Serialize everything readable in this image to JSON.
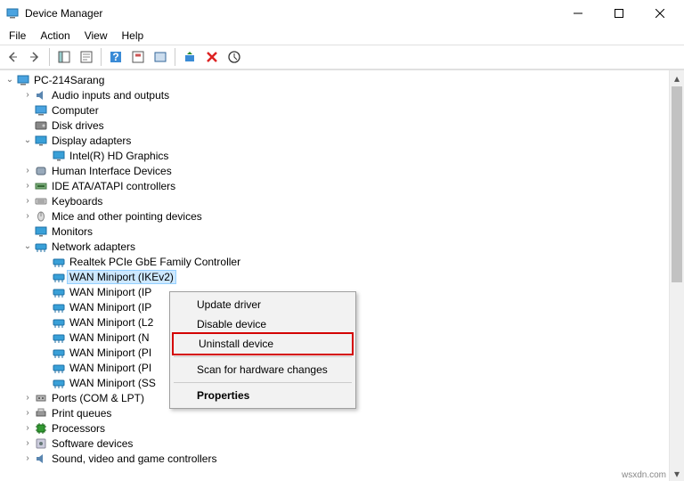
{
  "window": {
    "title": "Device Manager"
  },
  "menubar": [
    "File",
    "Action",
    "View",
    "Help"
  ],
  "tree": {
    "root": "PC-214Sarang",
    "items": [
      {
        "label": "Audio inputs and outputs",
        "expand": ">",
        "icon": "audio"
      },
      {
        "label": "Computer",
        "expand": "",
        "icon": "computer"
      },
      {
        "label": "Disk drives",
        "expand": "",
        "icon": "disk"
      },
      {
        "label": "Display adapters",
        "expand": "v",
        "icon": "display",
        "children": [
          {
            "label": "Intel(R) HD Graphics",
            "icon": "display"
          }
        ]
      },
      {
        "label": "Human Interface Devices",
        "expand": ">",
        "icon": "hid"
      },
      {
        "label": "IDE ATA/ATAPI controllers",
        "expand": ">",
        "icon": "ide"
      },
      {
        "label": "Keyboards",
        "expand": ">",
        "icon": "keyboard"
      },
      {
        "label": "Mice and other pointing devices",
        "expand": ">",
        "icon": "mouse"
      },
      {
        "label": "Monitors",
        "expand": "",
        "icon": "monitor"
      },
      {
        "label": "Network adapters",
        "expand": "v",
        "icon": "network",
        "children": [
          {
            "label": "Realtek PCIe GbE Family Controller",
            "icon": "network"
          },
          {
            "label": "WAN Miniport (IKEv2)",
            "icon": "network",
            "selected": true
          },
          {
            "label": "WAN Miniport (IP",
            "icon": "network"
          },
          {
            "label": "WAN Miniport (IP",
            "icon": "network"
          },
          {
            "label": "WAN Miniport (L2",
            "icon": "network"
          },
          {
            "label": "WAN Miniport (N",
            "icon": "network"
          },
          {
            "label": "WAN Miniport (PI",
            "icon": "network"
          },
          {
            "label": "WAN Miniport (PI",
            "icon": "network"
          },
          {
            "label": "WAN Miniport (SS",
            "icon": "network"
          }
        ]
      },
      {
        "label": "Ports (COM & LPT)",
        "expand": ">",
        "icon": "ports"
      },
      {
        "label": "Print queues",
        "expand": ">",
        "icon": "print"
      },
      {
        "label": "Processors",
        "expand": ">",
        "icon": "cpu"
      },
      {
        "label": "Software devices",
        "expand": ">",
        "icon": "software"
      },
      {
        "label": "Sound, video and game controllers",
        "expand": ">",
        "icon": "audio"
      }
    ]
  },
  "context_menu": {
    "items": [
      {
        "label": "Update driver"
      },
      {
        "label": "Disable device"
      },
      {
        "label": "Uninstall device",
        "highlight": true
      },
      {
        "sep": true
      },
      {
        "label": "Scan for hardware changes"
      },
      {
        "sep": true
      },
      {
        "label": "Properties",
        "bold": true
      }
    ]
  },
  "watermark": "wsxdn.com"
}
